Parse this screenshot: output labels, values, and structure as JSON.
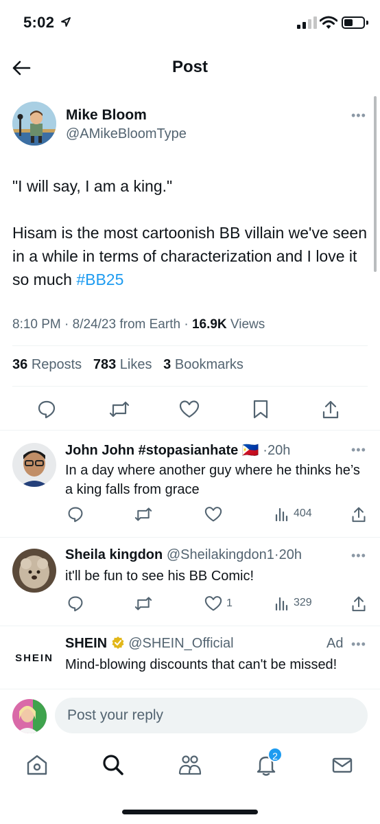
{
  "status_bar": {
    "time": "5:02",
    "battery_level": 0.45
  },
  "header": {
    "title": "Post"
  },
  "post": {
    "author_name": "Mike Bloom",
    "author_handle": "@AMikeBloomType",
    "text_line1": "\"I will say, I am a king.\"",
    "text_body": "Hisam is the most cartoonish BB villain we've seen in a while in terms of characterization and I love it so much ",
    "hashtag": "#BB25",
    "time": "8:10 PM",
    "date": "8/24/23",
    "source": "from Earth",
    "views_count": "16.9K",
    "views_label": "Views",
    "reposts_count": "36",
    "reposts_label": "Reposts",
    "likes_count": "783",
    "likes_label": "Likes",
    "bookmarks_count": "3",
    "bookmarks_label": "Bookmarks"
  },
  "replies": [
    {
      "name": "John John #stopasianhate",
      "flag": "🇵🇭",
      "handle": "",
      "age": "20h",
      "text": "In a day where another guy where he thinks he’s a king falls from grace",
      "likes": "",
      "views": "404"
    },
    {
      "name": "Sheila kingdon",
      "handle": "@Sheilakingdon1",
      "age": "20h",
      "text": "it'll be fun to see his BB Comic!",
      "likes": "1",
      "views": "329"
    }
  ],
  "ad": {
    "name": "SHEIN",
    "handle": "@SHEIN_Official",
    "ad_label": "Ad",
    "logo_text": "SHEIN",
    "text": "Mind-blowing discounts that can't be missed!"
  },
  "reply_box": {
    "placeholder": "Post your reply"
  },
  "tab_bar": {
    "notifications_badge": "2"
  },
  "colors": {
    "accent": "#1d9bf0",
    "text": "#0f1419",
    "muted": "#536471",
    "verified_gold": "#e2b719"
  }
}
